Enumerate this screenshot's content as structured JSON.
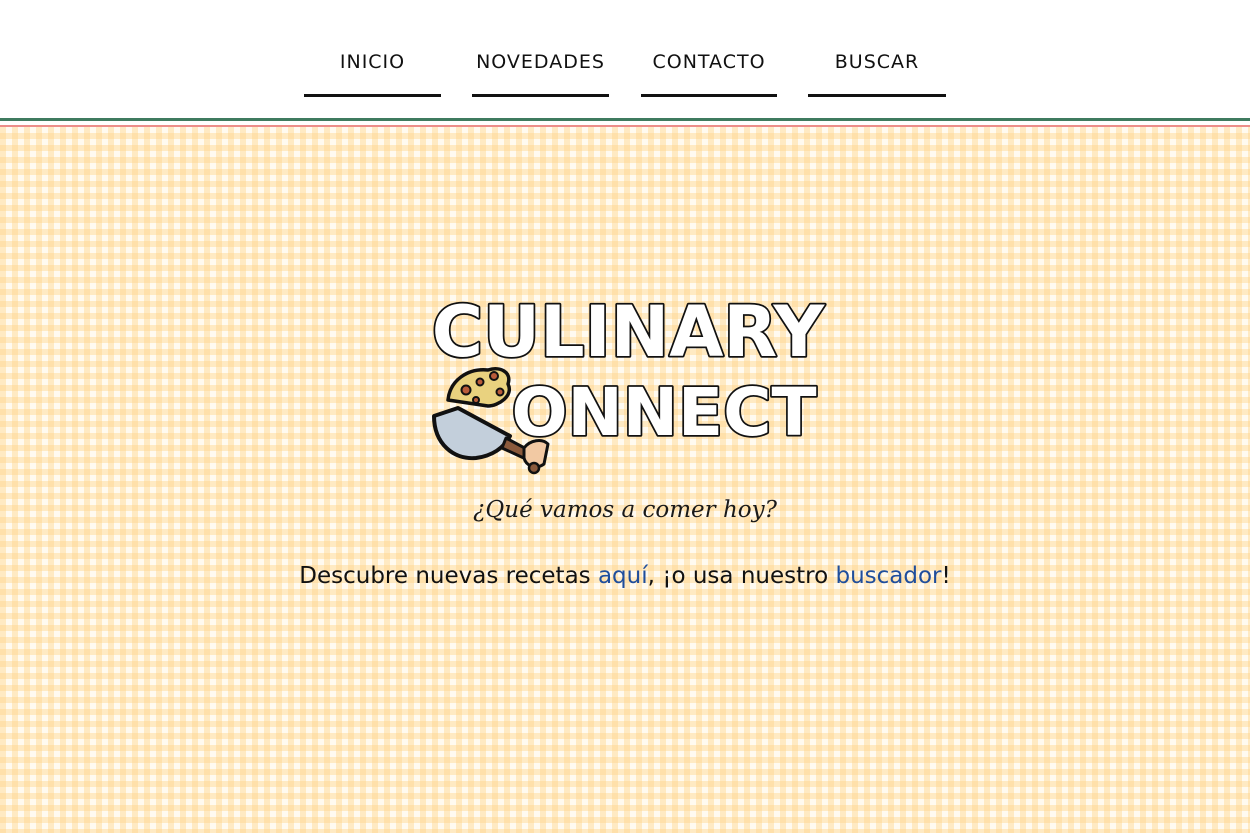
{
  "nav": {
    "items": [
      {
        "label": "INICIO"
      },
      {
        "label": "NOVEDADES"
      },
      {
        "label": "CONTACTO"
      },
      {
        "label": "BUSCAR"
      }
    ]
  },
  "logo": {
    "line1": "CULINARY",
    "line2": "ONNECT"
  },
  "hero": {
    "tagline": "¿Qué vamos a comer hoy?",
    "cta_prefix": "Descubre nuevas recetas ",
    "cta_link1": "aquí",
    "cta_middle": ", ¡o usa nuestro ",
    "cta_link2": "buscador",
    "cta_suffix": "!"
  },
  "colors": {
    "stripe_green": "#3f7b5f",
    "stripe_red": "#ec8e8a",
    "link": "#1f4e9c",
    "gingham": "#ffd68c"
  }
}
